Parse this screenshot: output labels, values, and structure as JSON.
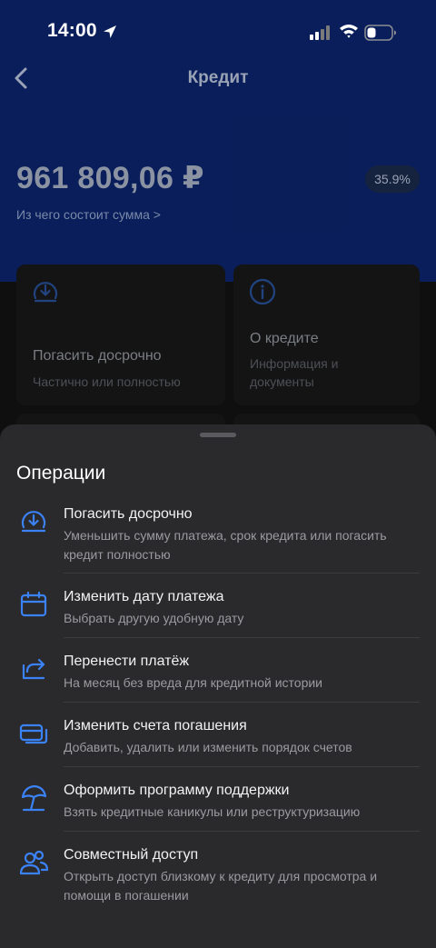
{
  "status_bar": {
    "time": "14:00"
  },
  "nav": {
    "title": "Кредит"
  },
  "loan": {
    "amount": "961 809,06 ₽",
    "rate": "35.9%",
    "breakdown_link": "Из чего состоит сумма >"
  },
  "cards": [
    {
      "title": "Погасить досрочно",
      "subtitle": "Частично или полностью"
    },
    {
      "title": "О кредите",
      "subtitle": "Информация и документы"
    }
  ],
  "sheet": {
    "title": "Операции",
    "items": [
      {
        "title": "Погасить досрочно",
        "subtitle": "Уменьшить сумму платежа, срок кредита или погасить кредит полностью",
        "icon": "early-repay-icon"
      },
      {
        "title": "Изменить дату платежа",
        "subtitle": "Выбрать другую удобную дату",
        "icon": "calendar-icon"
      },
      {
        "title": "Перенести платёж",
        "subtitle": "На месяц без вреда для кредитной истории",
        "icon": "forward-arrow-icon"
      },
      {
        "title": "Изменить счета погашения",
        "subtitle": "Добавить, удалить или изменить порядок счетов",
        "icon": "cards-icon"
      },
      {
        "title": "Оформить программу поддержки",
        "subtitle": "Взять кредитные каникулы или реструктуризацию",
        "icon": "umbrella-icon"
      },
      {
        "title": "Совместный доступ",
        "subtitle": "Открыть доступ близкому к кредиту для просмотра и помощи в погашении",
        "icon": "users-icon"
      }
    ]
  },
  "colors": {
    "header_blue": "#0f2e8a",
    "accent_blue": "#3b82f6",
    "sheet_bg": "#2a2a2c"
  }
}
